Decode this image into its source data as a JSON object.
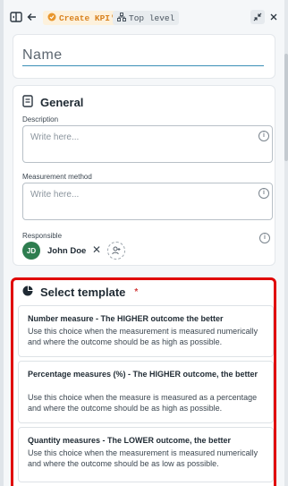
{
  "topbar": {
    "create_chip": "Create KPI's",
    "top_chip": "Top level"
  },
  "name_field": {
    "placeholder": "Name"
  },
  "general": {
    "title": "General",
    "description_label": "Description",
    "description_placeholder": "Write here...",
    "measurement_label": "Measurement method",
    "measurement_placeholder": "Write here...",
    "responsible_label": "Responsible",
    "responsible": {
      "initials": "JD",
      "name": "John Doe"
    }
  },
  "template": {
    "title": "Select template",
    "required_mark": "*",
    "options": [
      {
        "title": "Number measure - The HIGHER outcome the better",
        "description": "Use this choice when the measurement is measured numerically and where the outcome should be as high as possible."
      },
      {
        "title": "Percentage measures (%) - The HIGHER outcome, the better",
        "description": "Use this choice when the measure is measured as a percentage and where the outcome should be as high as possible."
      },
      {
        "title": "Quantity measures - The LOWER outcome, the better",
        "description": "Use this choice when the measurement is measured numerically and where the outcome should be as low as possible."
      }
    ]
  },
  "colors": {
    "accent": "#3a8fb7",
    "highlight_border": "#e00000",
    "avatar": "#2e7d4f",
    "chip_create": "#d9821e"
  },
  "icons": [
    "panel-toggle-icon",
    "back-arrow-icon",
    "kpi-icon",
    "hierarchy-icon",
    "collapse-icon",
    "close-icon",
    "document-icon",
    "pie-chart-icon",
    "info-icon",
    "add-user-icon"
  ]
}
